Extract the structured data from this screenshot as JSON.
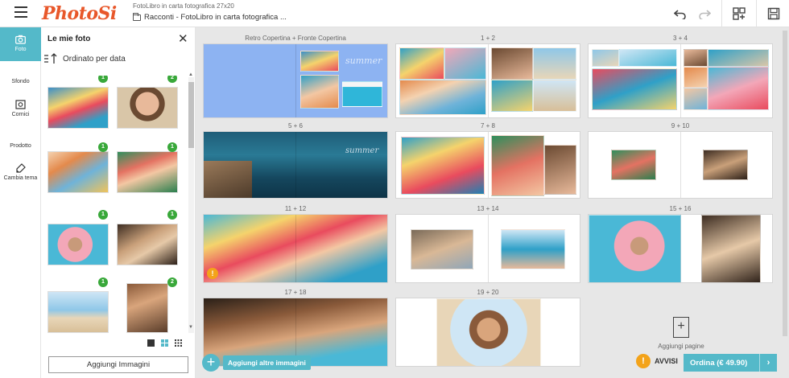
{
  "app": {
    "logo": "PhotoSi",
    "doc_title": "FotoLibro in carta fotografica 27x20",
    "doc_path": "Racconti - FotoLibro in carta fotografica ..."
  },
  "rail": [
    {
      "label": "Foto",
      "icon": "camera-icon",
      "active": true
    },
    {
      "label": "Sfondo",
      "icon": "",
      "active": false
    },
    {
      "label": "Cornici",
      "icon": "frame-icon",
      "active": false
    },
    {
      "label": "Prodotto",
      "icon": "",
      "active": false
    },
    {
      "label": "Cambia tema",
      "icon": "brush-icon",
      "active": false
    }
  ],
  "panel": {
    "title": "Le mie foto",
    "sort_label": "Ordinato per data",
    "add_images_label": "Aggiungi Immagini",
    "photos": [
      {
        "badge": "1"
      },
      {
        "badge": "2"
      },
      {
        "badge": "1"
      },
      {
        "badge": "1"
      },
      {
        "badge": "1"
      },
      {
        "badge": "1"
      },
      {
        "badge": "1"
      },
      {
        "badge": "2"
      }
    ]
  },
  "canvas": {
    "spreads": [
      {
        "label": "Retro Copertina + Fronte Copertina"
      },
      {
        "label": "1 + 2"
      },
      {
        "label": "3 + 4"
      },
      {
        "label": "5 + 6"
      },
      {
        "label": "7 + 8"
      },
      {
        "label": "9 + 10"
      },
      {
        "label": "11 + 12"
      },
      {
        "label": "13 + 14"
      },
      {
        "label": "15 + 16"
      },
      {
        "label": "17 + 18"
      },
      {
        "label": "19 + 20"
      }
    ],
    "cover_text": "summer",
    "spread5_text": "summer",
    "add_pages_label": "Aggiungi pagine",
    "add_more_label": "Aggiungi altre immagini",
    "alerts_label": "AVVISI",
    "order_label": "Ordina (€ 49.90)",
    "warning_symbol": "!"
  },
  "colors": {
    "brand": "#e8572a",
    "accent": "#54b9c9",
    "badge_green": "#39a83a",
    "warning": "#f3a31a",
    "cover_blue": "#8db3f2"
  }
}
